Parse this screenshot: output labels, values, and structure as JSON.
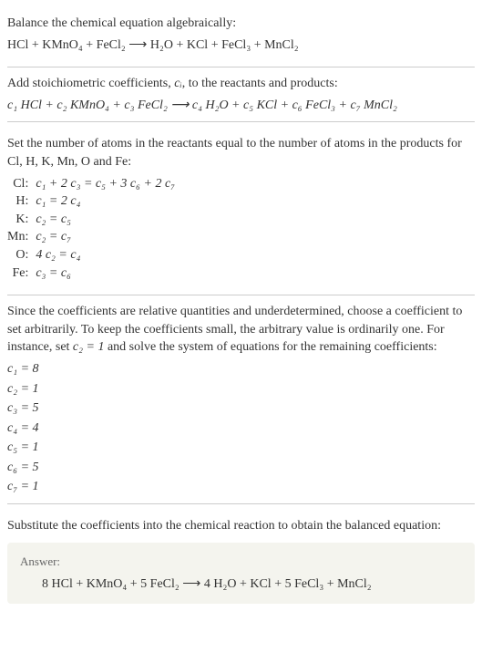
{
  "section1": {
    "title": "Balance the chemical equation algebraically:",
    "equation": "HCl + KMnO₄ + FeCl₂  ⟶  H₂O + KCl + FeCl₃ + MnCl₂"
  },
  "section2": {
    "title_pre": "Add stoichiometric coefficients, ",
    "title_ci": "cᵢ",
    "title_post": ", to the reactants and products:",
    "equation": "c₁ HCl + c₂ KMnO₄ + c₃ FeCl₂  ⟶  c₄ H₂O + c₅ KCl + c₆ FeCl₃ + c₇ MnCl₂"
  },
  "section3": {
    "title": "Set the number of atoms in the reactants equal to the number of atoms in the products for Cl, H, K, Mn, O and Fe:",
    "rows": [
      {
        "label": "Cl:",
        "value": "c₁ + 2 c₃ = c₅ + 3 c₆ + 2 c₇"
      },
      {
        "label": "H:",
        "value": "c₁ = 2 c₄"
      },
      {
        "label": "K:",
        "value": "c₂ = c₅"
      },
      {
        "label": "Mn:",
        "value": "c₂ = c₇"
      },
      {
        "label": "O:",
        "value": "4 c₂ = c₄"
      },
      {
        "label": "Fe:",
        "value": "c₃ = c₆"
      }
    ]
  },
  "section4": {
    "title_pre": "Since the coefficients are relative quantities and underdetermined, choose a coefficient to set arbitrarily. To keep the coefficients small, the arbitrary value is ordinarily one. For instance, set ",
    "title_c2": "c₂ = 1",
    "title_post": " and solve the system of equations for the remaining coefficients:",
    "coeffs": [
      "c₁ = 8",
      "c₂ = 1",
      "c₃ = 5",
      "c₄ = 4",
      "c₅ = 1",
      "c₆ = 5",
      "c₇ = 1"
    ]
  },
  "section5": {
    "title": "Substitute the coefficients into the chemical reaction to obtain the balanced equation:",
    "answer_label": "Answer:",
    "answer_equation": "8 HCl + KMnO₄ + 5 FeCl₂  ⟶  4 H₂O + KCl + 5 FeCl₃ + MnCl₂"
  }
}
